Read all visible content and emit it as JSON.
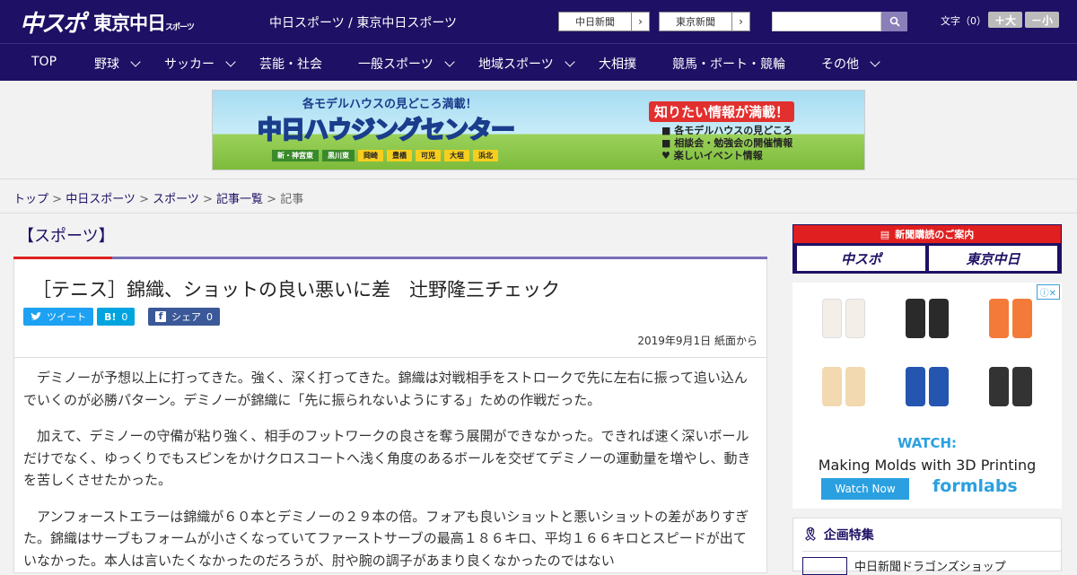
{
  "header": {
    "logo_main": "中スポ",
    "logo_tokyo": "東京中日",
    "logo_tokyo_small": "スポーツ",
    "site_links": "中日スポーツ / 東京中日スポーツ",
    "paper_buttons": [
      "中日新聞",
      "東京新聞"
    ],
    "fontsize_label": "文字（0）",
    "fontsize_up": "＋大",
    "fontsize_down": "－小"
  },
  "nav": [
    "TOP",
    "野球",
    "サッカー",
    "芸能・社会",
    "一般スポーツ",
    "地域スポーツ",
    "大相撲",
    "競馬・ボート・競輪",
    "その他"
  ],
  "ad_banner": {
    "top_line": "各モデルハウスの見どころ満載！",
    "title": "中日ハウジングセンター",
    "right_head": "知りたい情報が満載！",
    "right_lines": [
      "各モデルハウスの見どころ",
      "相談会・勉強会の開催情報",
      "楽しいイベント情報"
    ],
    "towns": [
      "新・神宮東",
      "黒川東",
      "岡崎",
      "豊橋",
      "可児",
      "大垣",
      "浜北"
    ]
  },
  "breadcrumb": {
    "links": [
      "トップ",
      "中日スポーツ",
      "スポーツ",
      "記事一覧"
    ],
    "current": "記事",
    "separator": " > "
  },
  "article": {
    "category": "【スポーツ】",
    "title": "［テニス］錦織、ショットの良い悪いに差　辻野隆三チェック",
    "tweet_label": "ツイート",
    "hatena_label": "B!",
    "hatena_count": "0",
    "share_label": "シェア",
    "share_count": "0",
    "date": "2019年9月1日 紙面から",
    "paragraphs": [
      "デミノーが予想以上に打ってきた。強く、深く打ってきた。錦織は対戦相手をストロークで先に左右に振って追い込んでいくのが必勝パターン。デミノーが錦織に「先に振られないようにする」ための作戦だった。",
      "加えて、デミノーの守備が粘り強く、相手のフットワークの良さを奪う展開ができなかった。できれば速く深いボールだけでなく、ゆっくりでもスピンをかけクロスコートへ浅く角度のあるボールを交ぜてデミノーの運動量を増やし、動きを苦しくさせたかった。",
      "アンフォーストエラーは錦織が６０本とデミノーの２９本の倍。フォアも良いショットと悪いショットの差がありすぎた。錦織はサーブもフォームが小さくなっていてファーストサーブの最高１８６キロ、平均１６６キロとスピードが出ていなかった。本人は言いたくなかったのだろうが、肘や腕の調子があまり良くなかったのではない"
    ]
  },
  "sidebar": {
    "subscribe_head": "新聞購読のご案内",
    "subscribe_logos": [
      "中スポ",
      "東京中日"
    ],
    "ad_watch": "WATCH:",
    "ad_subtitle": "Making Molds with 3D Printing",
    "ad_button": "Watch Now",
    "ad_brand": "formlabs",
    "feature_title": "企画特集",
    "feature_item": "中日新聞ドラゴンズショップ"
  },
  "colors": {
    "navy": "#1e1064",
    "accent_red": "#e02020",
    "twitter": "#1da1f2",
    "hatena": "#00a4de",
    "facebook": "#3b5998"
  }
}
